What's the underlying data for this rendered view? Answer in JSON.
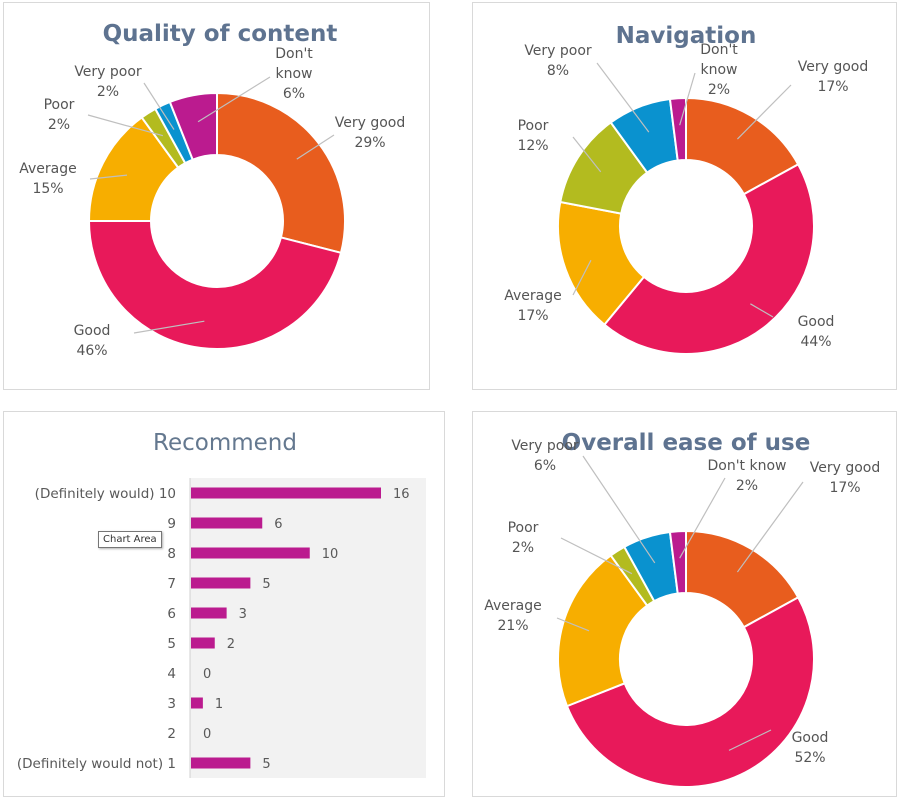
{
  "colors": {
    "very_good": "#e85d1e",
    "good": "#e8195a",
    "average": "#f7ae00",
    "poor": "#b3bb1f",
    "very_poor": "#0a92cf",
    "dont_know": "#bb1b8f",
    "bar": "#bb1b8f"
  },
  "tooltip": "Chart Area",
  "chart_data": [
    {
      "type": "pie",
      "title": "Quality of content",
      "categories": [
        "Very good",
        "Good",
        "Average",
        "Poor",
        "Very poor",
        "Don't know"
      ],
      "labels": [
        [
          "Very good"
        ],
        [
          "Good"
        ],
        [
          "Average"
        ],
        [
          "Poor"
        ],
        [
          "Very poor"
        ],
        [
          "Don't",
          "know"
        ]
      ],
      "values": [
        29,
        46,
        15,
        2,
        2,
        6
      ],
      "display": [
        "29%",
        "46%",
        "15%",
        "2%",
        "2%",
        "6%"
      ]
    },
    {
      "type": "pie",
      "title": "Navigation",
      "categories": [
        "Very good",
        "Good",
        "Average",
        "Poor",
        "Very poor",
        "Don't know"
      ],
      "labels": [
        [
          "Very good"
        ],
        [
          "Good"
        ],
        [
          "Average"
        ],
        [
          "Poor"
        ],
        [
          "Very poor"
        ],
        [
          "Don't",
          "know"
        ]
      ],
      "values": [
        17,
        44,
        17,
        12,
        8,
        2
      ],
      "display": [
        "17%",
        "44%",
        "17%",
        "12%",
        "8%",
        "2%"
      ]
    },
    {
      "type": "bar",
      "title": "Recommend",
      "categories": [
        "(Definitely would) 10",
        "9",
        "8",
        "7",
        "6",
        "5",
        "4",
        "3",
        "2",
        "(Definitely would not) 1"
      ],
      "values": [
        16,
        6,
        10,
        5,
        3,
        2,
        0,
        1,
        0,
        5
      ],
      "xlim": [
        0,
        20
      ]
    },
    {
      "type": "pie",
      "title": "Overall ease of use",
      "categories": [
        "Very good",
        "Good",
        "Average",
        "Poor",
        "Very poor",
        "Don't know"
      ],
      "labels": [
        [
          "Very good"
        ],
        [
          "Good"
        ],
        [
          "Average"
        ],
        [
          "Poor"
        ],
        [
          "Very poor"
        ],
        [
          "Don't know"
        ]
      ],
      "values": [
        17,
        52,
        21,
        2,
        6,
        2
      ],
      "display": [
        "17%",
        "52%",
        "21%",
        "2%",
        "6%",
        "2%"
      ]
    }
  ]
}
